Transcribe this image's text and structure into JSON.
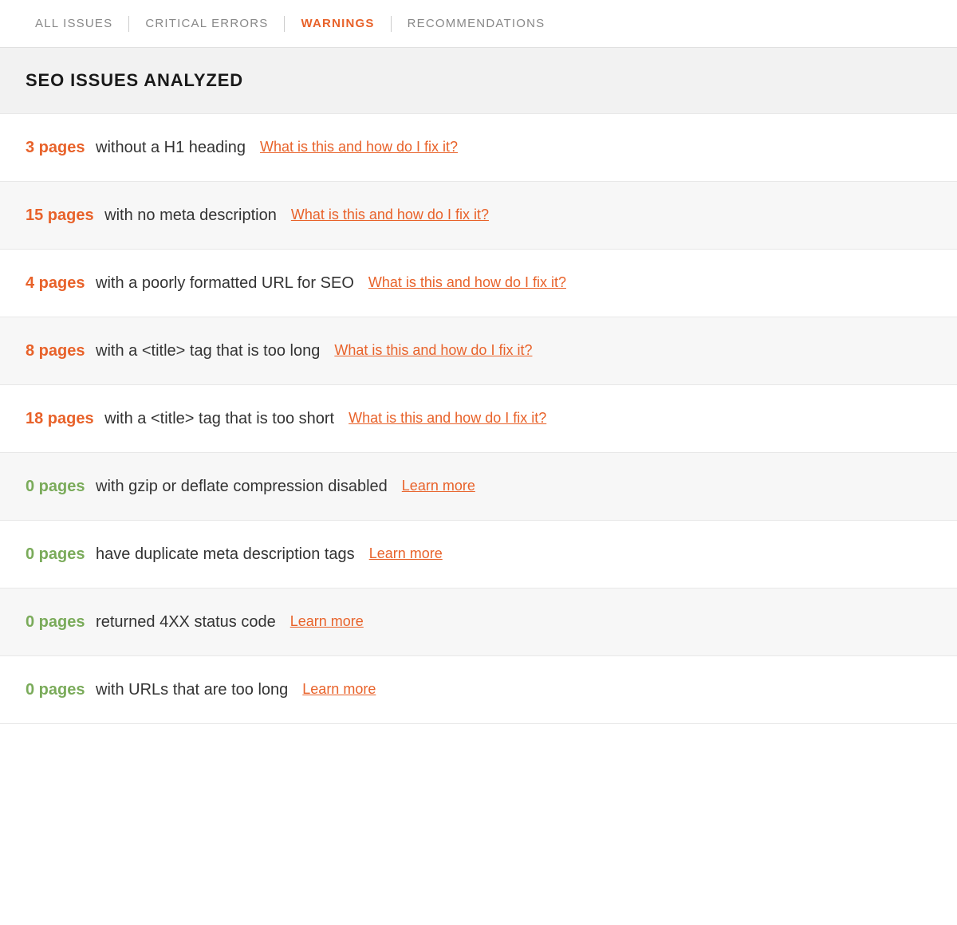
{
  "nav": {
    "tabs": [
      {
        "id": "all-issues",
        "label": "ALL ISSUES",
        "active": false
      },
      {
        "id": "critical-errors",
        "label": "CRITICAL ERRORS",
        "active": false
      },
      {
        "id": "warnings",
        "label": "WARNINGS",
        "active": true
      },
      {
        "id": "recommendations",
        "label": "RECOMMENDATIONS",
        "active": false
      }
    ]
  },
  "section": {
    "title": "SEO ISSUES ANALYZED"
  },
  "issues": [
    {
      "id": "h1-heading",
      "count": "3 pages",
      "zero": false,
      "text": "without a H1 heading",
      "link_label": "What is this and how do I fix it?",
      "shaded": false
    },
    {
      "id": "meta-description",
      "count": "15 pages",
      "zero": false,
      "text": "with no meta description",
      "link_label": "What is this and how do I fix it?",
      "shaded": true
    },
    {
      "id": "url-format",
      "count": "4 pages",
      "zero": false,
      "text": "with a poorly formatted URL for SEO",
      "link_label": "What is this and how do I fix it?",
      "shaded": false
    },
    {
      "id": "title-too-long",
      "count": "8 pages",
      "zero": false,
      "text": "with a <title> tag that is too long",
      "link_label": "What is this and how do I fix it?",
      "shaded": true
    },
    {
      "id": "title-too-short",
      "count": "18 pages",
      "zero": false,
      "text": "with a <title> tag that is too short",
      "link_label": "What is this and how do I fix it?",
      "shaded": false
    },
    {
      "id": "gzip-compression",
      "count": "0 pages",
      "zero": true,
      "text": "with gzip or deflate compression disabled",
      "link_label": "Learn more",
      "shaded": true
    },
    {
      "id": "duplicate-meta",
      "count": "0 pages",
      "zero": true,
      "text": "have duplicate meta description tags",
      "link_label": "Learn more",
      "shaded": false
    },
    {
      "id": "4xx-status",
      "count": "0 pages",
      "zero": true,
      "text": "returned 4XX status code",
      "link_label": "Learn more",
      "shaded": true
    },
    {
      "id": "url-too-long",
      "count": "0 pages",
      "zero": true,
      "text": "with URLs that are too long",
      "link_label": "Learn more",
      "shaded": false
    }
  ]
}
